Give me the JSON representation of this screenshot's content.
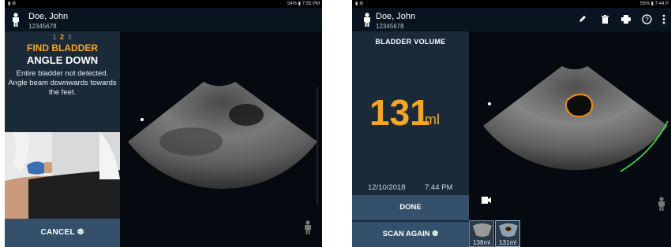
{
  "left": {
    "status": {
      "left": "▮ ⚙",
      "right": "54% ▮ 7:55 PM"
    },
    "patient": {
      "name": "Doe, John",
      "id": "12345678"
    },
    "steps": {
      "s1": "1",
      "s2": "2",
      "s3": "3"
    },
    "find_title": "FIND BLADDER",
    "angle_title": "ANGLE DOWN",
    "instruction": "Entire bladder not detected. Angle beam downwards towards the feet.",
    "cancel": "CANCEL ❆"
  },
  "right": {
    "status": {
      "left": "▮ ⚙",
      "right": "55% ▮ 7:44 P"
    },
    "patient": {
      "name": "Doe, John",
      "id": "12345678"
    },
    "volume_label": "BLADDER VOLUME",
    "volume_value": "131",
    "volume_unit": "ml",
    "date": "12/10/2018",
    "time": "7:44 PM",
    "done": "DONE",
    "scan_again": "SCAN AGAIN ❆",
    "thumbnails": [
      "138ml",
      "131ml"
    ],
    "toolbar_icons": [
      "edit-icon",
      "delete-icon",
      "print-icon",
      "help-icon",
      "more-icon"
    ]
  },
  "colors": {
    "accent": "#f5a623",
    "panel": "#1b2a39",
    "button": "#35506a",
    "outline": "#e08a1e",
    "arc": "#3fd24a"
  }
}
